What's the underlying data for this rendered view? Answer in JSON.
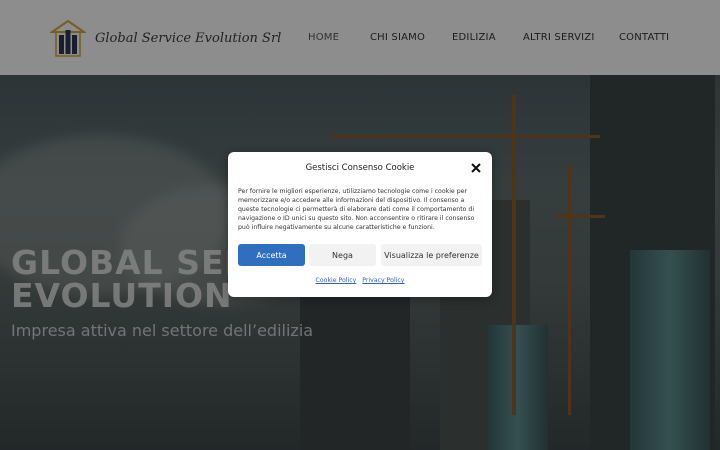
{
  "header": {
    "brand": "Global Service Evolution Srl",
    "logo_icon": "building-logo-icon",
    "nav": [
      {
        "label": "HOME",
        "active": true
      },
      {
        "label": "CHI SIAMO"
      },
      {
        "label": "EDILIZIA"
      },
      {
        "label": "ALTRI SERVIZI"
      },
      {
        "label": "CONTATTI"
      }
    ]
  },
  "hero": {
    "title_line1": "GLOBAL SERVICE",
    "title_line2": "EVOLUTION",
    "subtitle": "Impresa attiva nel settore dell’edilizia"
  },
  "cookie": {
    "title": "Gestisci Consenso Cookie",
    "text": "Per fornire le migliori esperienze, utilizziamo tecnologie come i cookie per memorizzare e/o accedere alle informazioni del dispositivo. Il consenso a queste tecnologie ci permetterà di elaborare dati come il comportamento di navigazione o ID unici su questo sito. Non acconsentire o ritirare il consenso può influire negativamente su alcune caratteristiche e funzioni.",
    "accept": "Accetta",
    "deny": "Nega",
    "prefs": "Visualizza le preferenze",
    "cookie_policy": "Cookie Policy",
    "privacy_policy": "Privacy Policy"
  },
  "colors": {
    "accent": "#2f6fbf",
    "header_bg": "#f3f3f3",
    "logo_gold": "#c9a23a"
  }
}
